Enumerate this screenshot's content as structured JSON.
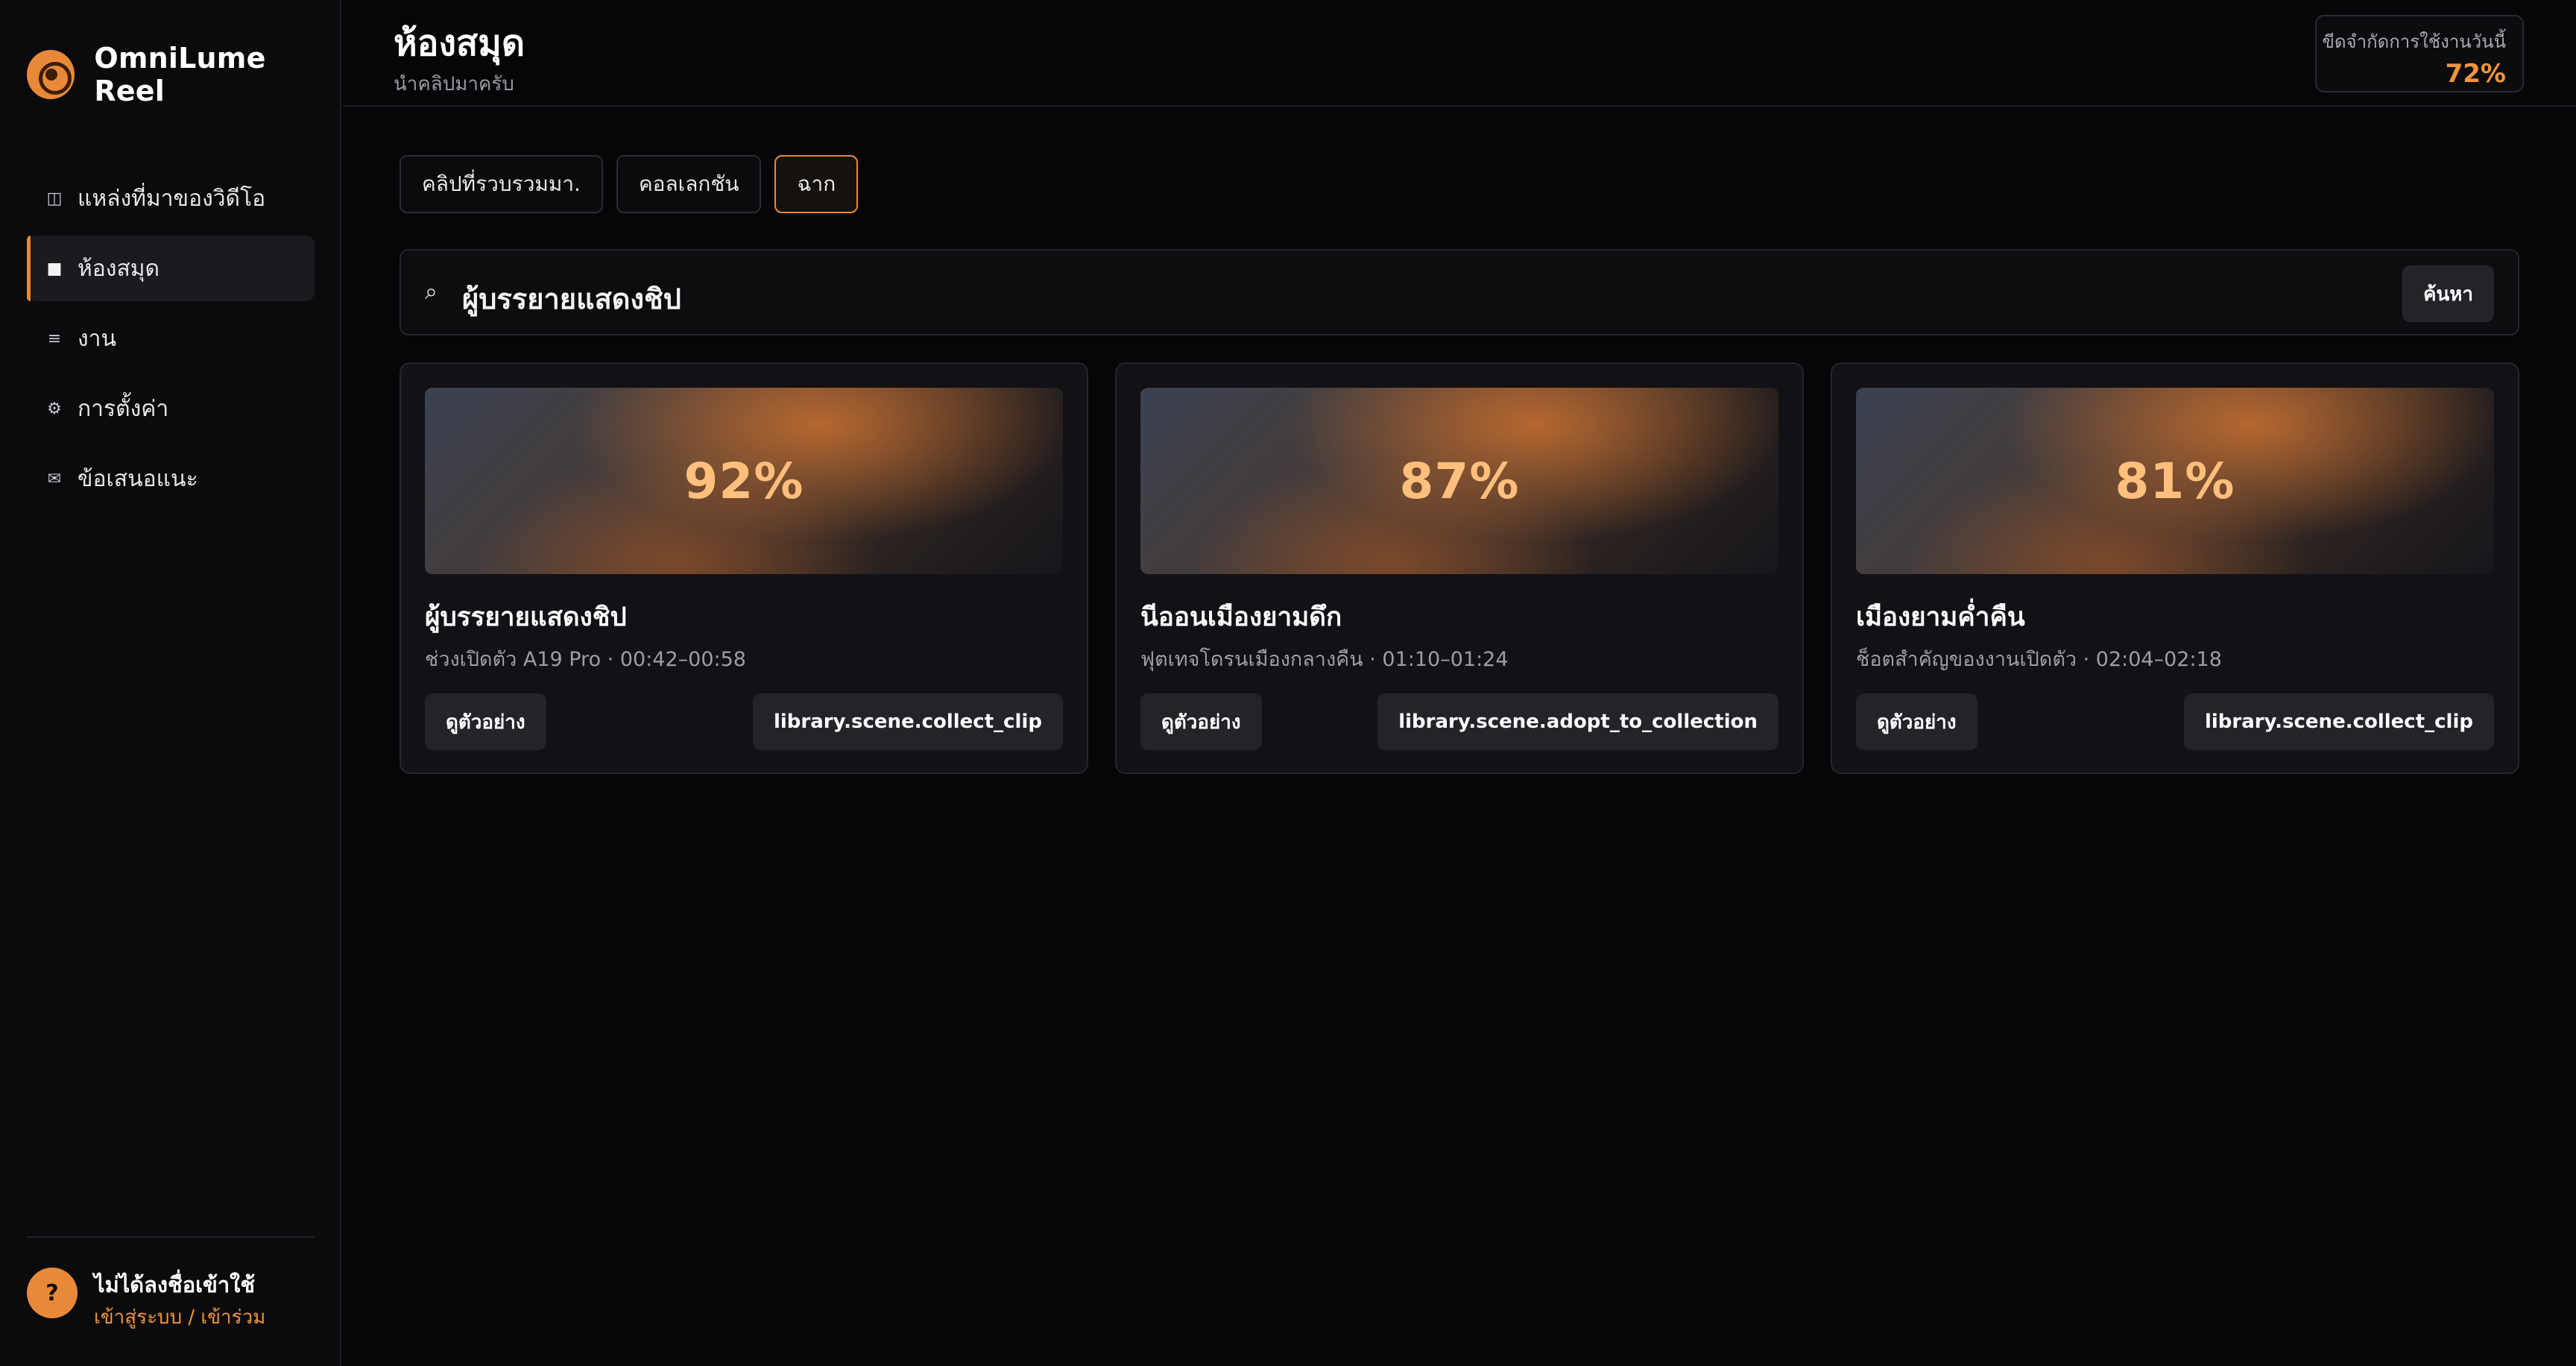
{
  "app": {
    "name": "OmniLume Reel",
    "accent_color": "#e8893a"
  },
  "sidebar": {
    "items": [
      {
        "label": "แหล่งที่มาของวิดีโอ",
        "icon": "columns-icon",
        "active": false
      },
      {
        "label": "ห้องสมุด",
        "icon": "square-icon",
        "active": true
      },
      {
        "label": "งาน",
        "icon": "menu-icon",
        "active": false
      },
      {
        "label": "การตั้งค่า",
        "icon": "gear-icon",
        "active": false
      },
      {
        "label": "ข้อเสนอแนะ",
        "icon": "mail-icon",
        "active": false
      }
    ],
    "user": {
      "avatar_glyph": "?",
      "name": "ไม่ได้ลงชื่อเข้าใช้",
      "link": "เข้าสู่ระบบ / เข้าร่วม"
    }
  },
  "header": {
    "title": "ห้องสมุด",
    "subtitle": "นำคลิปมาครับ",
    "quota": {
      "label": "ขีดจำกัดการใช้งานวันนี้",
      "value": "72%"
    }
  },
  "tabs": [
    {
      "label": "คลิปที่รวบรวมมา.",
      "active": false
    },
    {
      "label": "คอลเลกชัน",
      "active": false
    },
    {
      "label": "ฉาก",
      "active": true
    }
  ],
  "search": {
    "icon": "search-icon",
    "value": "ผู้บรรยายแสดงชิป",
    "button_label": "ค้นหา"
  },
  "cards": [
    {
      "score": "92%",
      "title": "ผู้บรรยายแสดงชิป",
      "meta": "ช่วงเปิดตัว A19 Pro · 00:42–00:58",
      "preview_label": "ดูตัวอย่าง",
      "action_label": "library.scene.collect_clip"
    },
    {
      "score": "87%",
      "title": "นีออนเมืองยามดึก",
      "meta": "ฟุตเทจโดรนเมืองกลางคืน · 01:10–01:24",
      "preview_label": "ดูตัวอย่าง",
      "action_label": "library.scene.adopt_to_collection"
    },
    {
      "score": "81%",
      "title": "เมืองยามค่ำคืน",
      "meta": "ช็อตสำคัญของงานเปิดตัว · 02:04–02:18",
      "preview_label": "ดูตัวอย่าง",
      "action_label": "library.scene.collect_clip"
    }
  ]
}
